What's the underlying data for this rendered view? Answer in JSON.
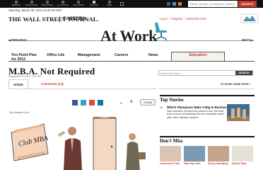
{
  "topbar": {
    "sites": [
      "Barron's",
      "MarketWatch",
      "SmartMoney",
      "All Things D",
      "Real Estate",
      "WSJ.com",
      "More"
    ],
    "active_site_index": 5,
    "search_placeholder": "News, Quotes, Companies, Videos",
    "search_button": "SEARCH"
  },
  "header": {
    "date": "Saturday, March 30, 2013 10:20:45 GMT",
    "wsj": "THE WALL STREET JOURNAL.",
    "section": "CAREERS",
    "login": "Log In",
    "register": "Register",
    "subscribe": "Subscribe Now",
    "blog_title": "At Work",
    "prev": "PREVIOUS",
    "next": "NEXT"
  },
  "nav": {
    "items": [
      "Ten-Point Plan for 2013",
      "Office Life",
      "Management",
      "Careers",
      "News",
      "Education"
    ],
    "active_index": 5
  },
  "article": {
    "title": "M.B.A. Not Required",
    "date": "September 5, 2012, 2:37 PM",
    "tabs": [
      "Article",
      "Comments (14)"
    ],
    "byline": "By Melissa Korn",
    "print": "Print",
    "text_small": "A",
    "text_big": "A",
    "home_link": "AT WORK HOME PAGE »"
  },
  "blog_search": {
    "placeholder": "Search At Work",
    "button": "SEARCH"
  },
  "illustration": {
    "sign_text": "Club MBA"
  },
  "colors": {
    "accent": "#c8392b",
    "chair": "#3ba0b5",
    "facebook": "#3b5998",
    "twitter": "#3a9cd0"
  },
  "top_stories": {
    "heading": "Top Stories",
    "label": "Ltr",
    "headline": "Which Olympians Make It Big In Business?",
    "text": "New research shows that careers have the best track record of breaking into the corporate world after their Olympic careers."
  },
  "dont_miss": {
    "heading": "Don't Miss",
    "captions": [
      "Lululemon Pulls",
      "How Pay Sets",
      "Sheryl Sandberg",
      "Dilbert Strip"
    ]
  }
}
